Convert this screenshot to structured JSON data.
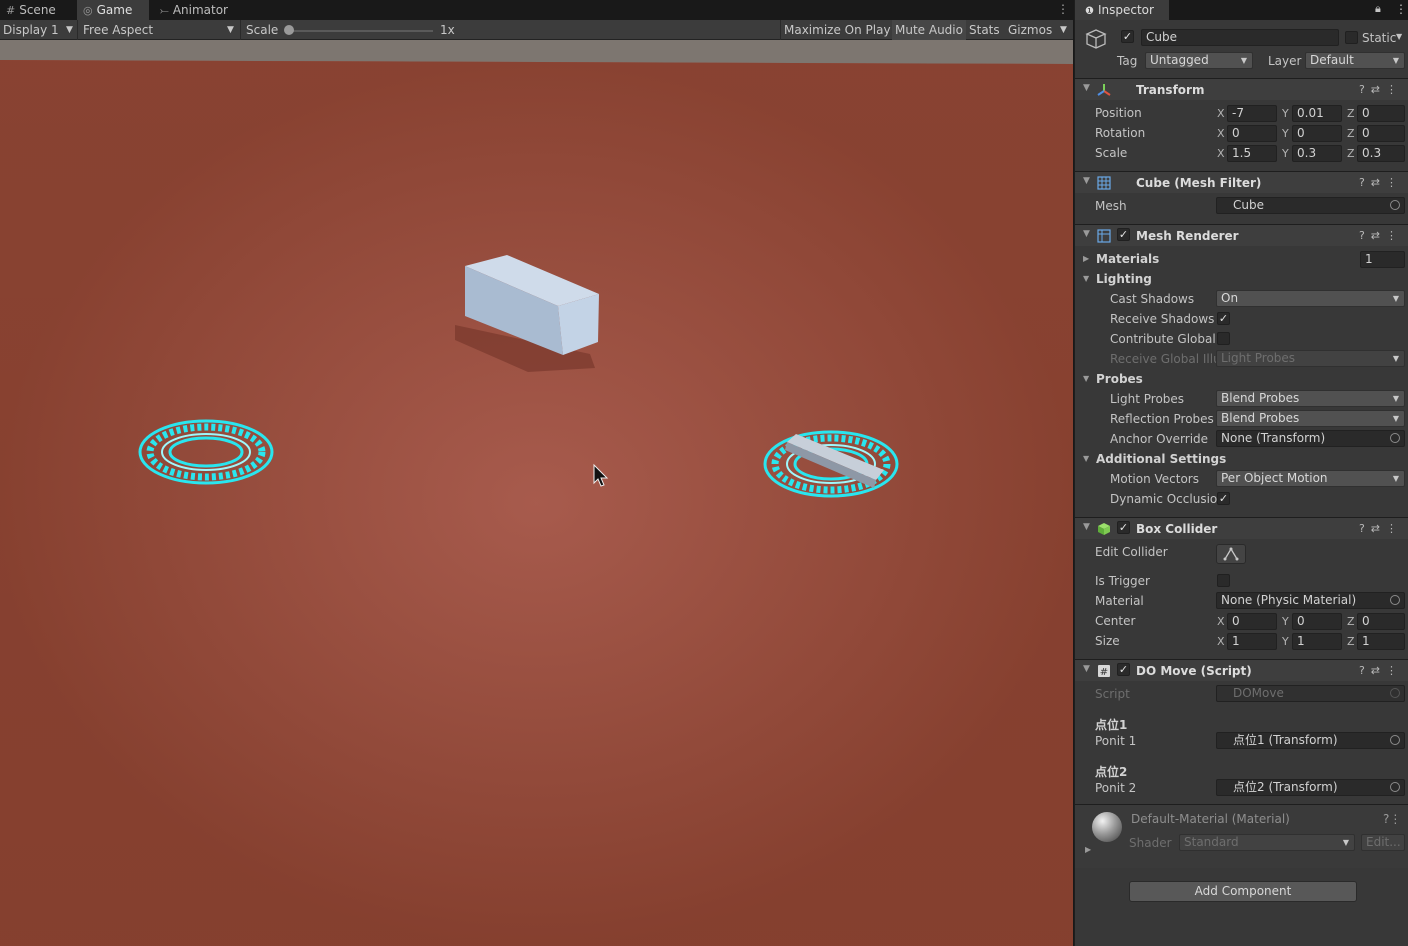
{
  "tabs": {
    "scene": "Scene",
    "game": "Game",
    "animator": "Animator"
  },
  "game_toolbar": {
    "display": "Display 1",
    "aspect": "Free Aspect",
    "scale_label": "Scale",
    "scale_value": 0,
    "scale_text": "1x",
    "maximize": "Maximize On Play",
    "mute": "Mute Audio",
    "stats": "Stats",
    "gizmos": "Gizmos"
  },
  "inspector": {
    "tab": "Inspector",
    "object_name": "Cube",
    "static_label": "Static",
    "tag_label": "Tag",
    "tag_value": "Untagged",
    "layer_label": "Layer",
    "layer_value": "Default",
    "transform": {
      "title": "Transform",
      "position_label": "Position",
      "rotation_label": "Rotation",
      "scale_label": "Scale",
      "position": {
        "x": "-7",
        "y": "0.01",
        "z": "0"
      },
      "rotation": {
        "x": "0",
        "y": "0",
        "z": "0"
      },
      "scale": {
        "x": "1.5",
        "y": "0.3",
        "z": "0.3"
      }
    },
    "mesh_filter": {
      "title": "Cube (Mesh Filter)",
      "mesh_label": "Mesh",
      "mesh_value": "Cube"
    },
    "mesh_renderer": {
      "title": "Mesh Renderer",
      "materials_label": "Materials",
      "materials_count": "1",
      "lighting_label": "Lighting",
      "cast_shadows_label": "Cast Shadows",
      "cast_shadows_value": "On",
      "receive_shadows_label": "Receive Shadows",
      "contribute_gi_label": "Contribute Global I",
      "receive_gi_label": "Receive Global Illu",
      "receive_gi_value": "Light Probes",
      "probes_label": "Probes",
      "light_probes_label": "Light Probes",
      "light_probes_value": "Blend Probes",
      "reflection_probes_label": "Reflection Probes",
      "reflection_probes_value": "Blend Probes",
      "anchor_override_label": "Anchor Override",
      "anchor_override_value": "None (Transform)",
      "additional_label": "Additional Settings",
      "motion_vectors_label": "Motion Vectors",
      "motion_vectors_value": "Per Object Motion",
      "dynamic_occlusion_label": "Dynamic Occlusio"
    },
    "box_collider": {
      "title": "Box Collider",
      "edit_collider_label": "Edit Collider",
      "is_trigger_label": "Is Trigger",
      "material_label": "Material",
      "material_value": "None (Physic Material)",
      "center_label": "Center",
      "size_label": "Size",
      "center": {
        "x": "0",
        "y": "0",
        "z": "0"
      },
      "size": {
        "x": "1",
        "y": "1",
        "z": "1"
      }
    },
    "do_move": {
      "title": "DO Move (Script)",
      "script_label": "Script",
      "script_value": "DOMove",
      "header1": "点位1",
      "ponit1_label": "Ponit 1",
      "ponit1_value": "点位1 (Transform)",
      "header2": "点位2",
      "ponit2_label": "Ponit 2",
      "ponit2_value": "点位2 (Transform)"
    },
    "material": {
      "title": "Default-Material (Material)",
      "shader_label": "Shader",
      "shader_value": "Standard",
      "edit_label": "Edit..."
    },
    "add_component": "Add Component"
  },
  "colors": {
    "ground": "#9a4e41",
    "ring": "#29e6ef",
    "cube": "#b9c9dc",
    "panel": "#383838"
  }
}
